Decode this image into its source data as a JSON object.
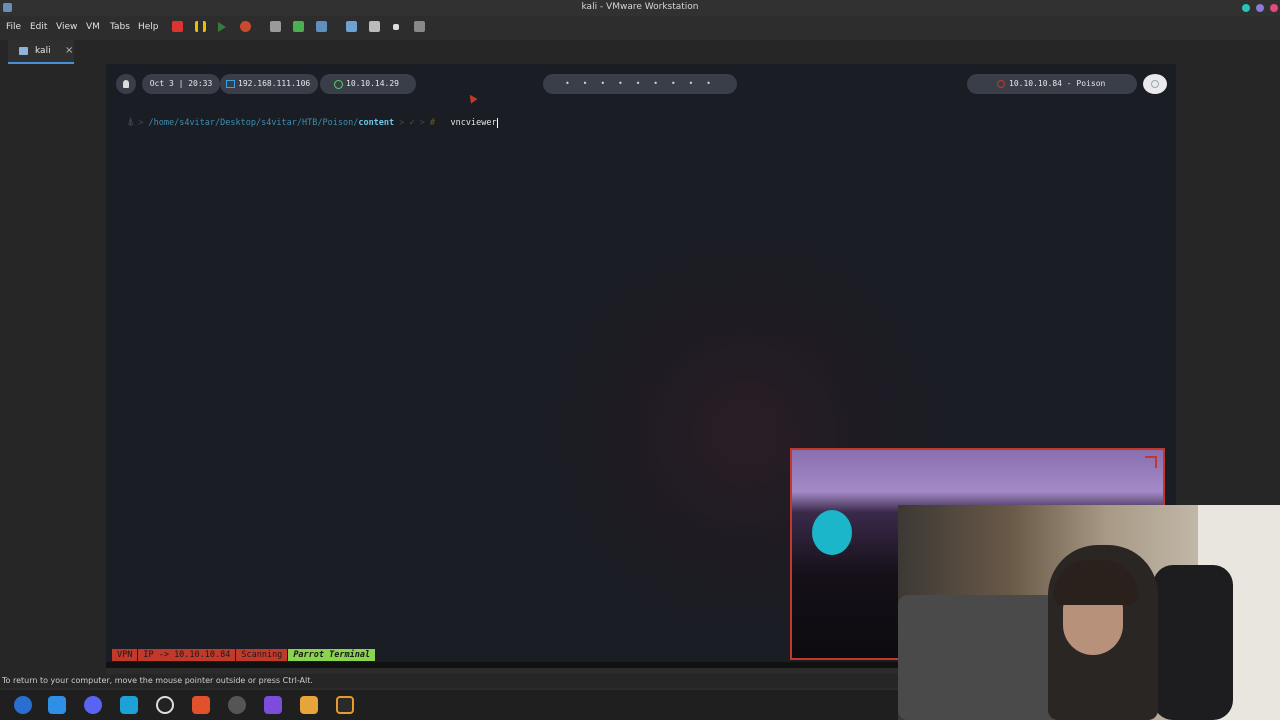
{
  "window": {
    "title": "kali - VMware Workstation"
  },
  "menu": [
    "File",
    "Edit",
    "View",
    "VM",
    "Tabs",
    "Help"
  ],
  "tabs": [
    {
      "label": "kali",
      "close": "×"
    }
  ],
  "guest": {
    "topbar": {
      "datetime": "Oct 3 | 20:33",
      "local_ip": "192.168.111.106",
      "vpn_ip": "10.10.14.29",
      "workspaces": "• • • • • • • • •",
      "target": "10.10.10.84 - Poison"
    },
    "prompt": {
      "arrow": "⍋",
      "path_prefix": "/home/s4vitar/Desktop/s4vitar/HTB/Poison/",
      "dir": "content",
      "check": "✓",
      "hash": "#",
      "command": "vncviewer"
    },
    "statusline": {
      "vpn": "VPN",
      "ip": "IP -> 10.10.10.84",
      "scanning": "Scanning",
      "terminal": "Parrot Terminal"
    }
  },
  "host_status": "To return to your computer, move the mouse pointer outside or press Ctrl-Alt.",
  "colors": {
    "accent": "#4a90d9",
    "status_red": "#c0392b",
    "status_green": "#8bd450"
  }
}
